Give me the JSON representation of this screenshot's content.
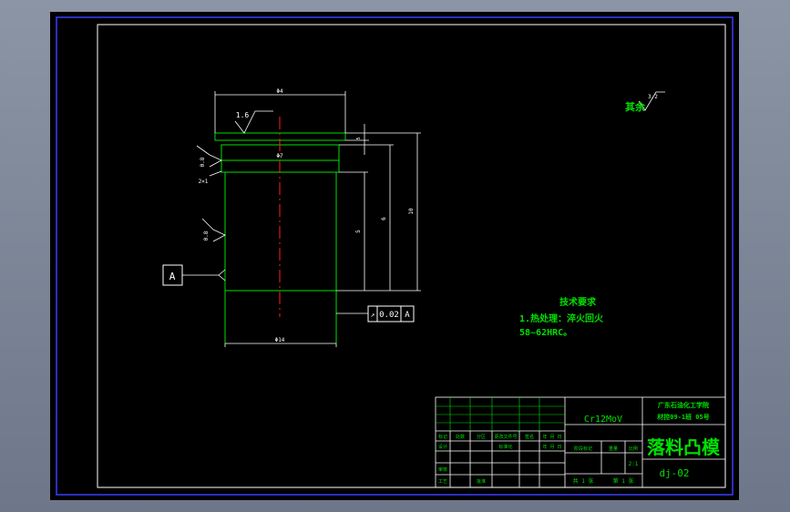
{
  "drawing": {
    "top_dim": "Φ4",
    "roughness_top": "1.6",
    "flange_dim": "Φ7",
    "roughness_side": "0.8",
    "chamfer": "2×1",
    "roughness_body": "0.8",
    "datum_label": "A",
    "height_dims": [
      "5",
      "5",
      "6",
      "10"
    ],
    "bottom_dim": "Φ14",
    "tolerance": {
      "symbol": "↗",
      "value": "0.02",
      "datum": "A"
    },
    "rest_roughness": "其余",
    "rest_roughness_value": "3.2",
    "tech_req": {
      "title": "技术要求",
      "line1": "1.热处理：淬火回火",
      "line2": "58~62HRC。"
    }
  },
  "title_block": {
    "material": "Cr12MoV",
    "school_line1": "广东石油化工学院",
    "school_line2": "材控09-1班 05号",
    "part_name": "落料凸模",
    "drawing_no": "dj-02",
    "scale": "2:1",
    "sheet": "共 1 张",
    "sheet2": "第 1 张",
    "row_labels": [
      "标记",
      "处数",
      "分区",
      "更改文件号",
      "签名",
      "年 月 日"
    ],
    "row2_labels": [
      "设计",
      "",
      "标准化",
      "",
      "年 月 日"
    ],
    "row3_labels": [
      "审核"
    ],
    "row4_labels": [
      "工艺",
      "",
      "批准"
    ],
    "stage_labels": [
      "阶段标记",
      "重量",
      "比例"
    ]
  }
}
